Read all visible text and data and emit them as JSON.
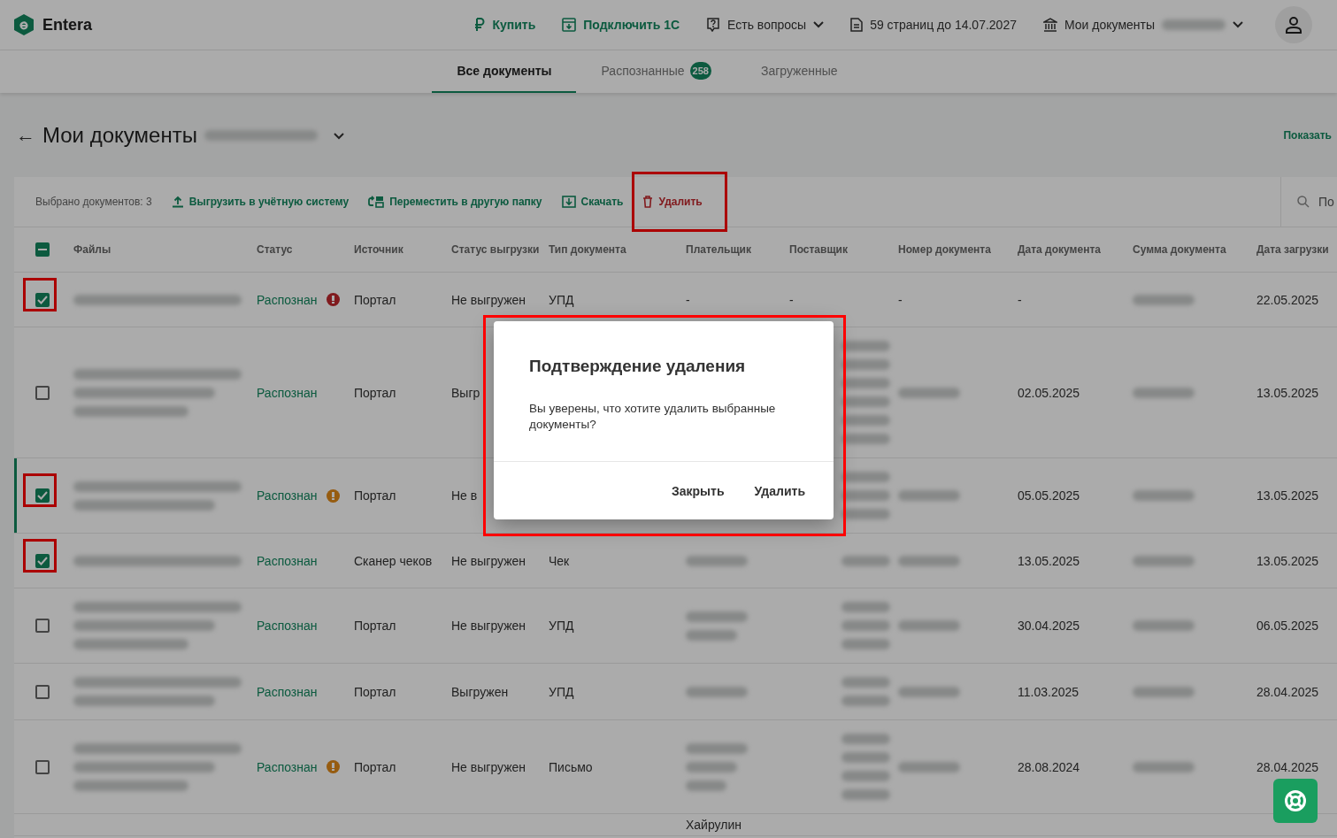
{
  "header": {
    "logo": "Entera",
    "actions": [
      {
        "kind": "buy",
        "label": "Купить"
      },
      {
        "kind": "connect",
        "label": "Подключить 1С"
      },
      {
        "kind": "help",
        "label": "Есть вопросы",
        "dropdown": true
      },
      {
        "kind": "pages",
        "label": "59 страниц до 14.07.2027",
        "dropdown": false
      },
      {
        "kind": "org",
        "label": "Мои документы",
        "dropdown": true,
        "blurred": true
      }
    ]
  },
  "tabs": [
    {
      "label": "Все документы",
      "selected": true
    },
    {
      "label": "Распознанные",
      "badge": "258",
      "selected": false
    },
    {
      "label": "Загруженные",
      "selected": false
    }
  ],
  "page_title": {
    "back": "←",
    "title": "Мои документы",
    "blurred": true
  },
  "show_link": "Показать",
  "toolbar": {
    "selected_count": "Выбрано документов: 3",
    "actions": [
      {
        "kind": "upload",
        "label": "Выгрузить в учётную систему",
        "danger": false,
        "highlighted": false
      },
      {
        "kind": "move",
        "label": "Переместить в другую папку",
        "danger": false,
        "highlighted": false
      },
      {
        "kind": "download",
        "label": "Скачать",
        "danger": false,
        "highlighted": false
      },
      {
        "kind": "delete",
        "label": "Удалить",
        "danger": true,
        "highlighted": true
      }
    ],
    "search": {
      "placeholder": "По"
    }
  },
  "table": {
    "select_all": {
      "indeterminate": true
    },
    "columns": [
      "Файлы",
      "Статус",
      "Источник",
      "Статус выгрузки",
      "Тип документа",
      "Плательщик",
      "Поставщик",
      "Номер документа",
      "Дата документа",
      "Сумма документа",
      "Дата загрузки"
    ],
    "rows": [
      {
        "checked": true,
        "highlighted": true,
        "active": false,
        "status_icon": {
          "color": "#801b1e"
        },
        "cells": [
          [
            {
              "kind": "blurred"
            }
          ],
          "Распознан",
          "Портал",
          "Не выгружен",
          "УПД",
          "-",
          "-",
          "-",
          "-",
          [
            {
              "kind": "blurred"
            }
          ],
          "22.05.2025"
        ]
      },
      {
        "checked": false,
        "highlighted": false,
        "active": false,
        "cells": [
          [
            {
              "kind": "blurred"
            },
            {
              "kind": "blurred"
            },
            {
              "kind": "blurred"
            }
          ],
          "Распознан",
          "Портал",
          "Выгр",
          null,
          null,
          [
            {
              "kind": "blurred"
            },
            {
              "kind": "blurred"
            },
            {
              "kind": "blurred"
            },
            {
              "kind": "blurred"
            },
            {
              "kind": "blurred"
            },
            {
              "kind": "blurred"
            }
          ],
          [
            {
              "kind": "blurred"
            }
          ],
          "02.05.2025",
          [
            {
              "kind": "blurred"
            }
          ],
          "13.05.2025"
        ]
      },
      {
        "checked": true,
        "highlighted": true,
        "active": true,
        "status_icon": {
          "color": "#965c11"
        },
        "cells": [
          [
            {
              "kind": "blurred"
            },
            {
              "kind": "blurred"
            }
          ],
          "Распознан",
          "Портал",
          "Не в",
          null,
          null,
          [
            {
              "kind": "blurred"
            },
            {
              "kind": "blurred"
            },
            {
              "kind": "blurred"
            }
          ],
          [
            {
              "kind": "blurred"
            }
          ],
          "05.05.2025",
          [
            {
              "kind": "blurred"
            }
          ],
          "13.05.2025"
        ]
      },
      {
        "checked": true,
        "highlighted": true,
        "active": false,
        "cells": [
          [
            {
              "kind": "blurred"
            }
          ],
          "Распознан",
          "Сканер чеков",
          "Не выгружен",
          "Чек",
          [
            {
              "kind": "blurred"
            }
          ],
          [
            {
              "kind": "blurred"
            }
          ],
          [
            {
              "kind": "blurred"
            }
          ],
          "13.05.2025",
          [
            {
              "kind": "blurred"
            }
          ],
          "13.05.2025"
        ]
      },
      {
        "checked": false,
        "highlighted": false,
        "active": false,
        "cells": [
          [
            {
              "kind": "blurred"
            },
            {
              "kind": "blurred"
            },
            {
              "kind": "blurred"
            }
          ],
          "Распознан",
          "Портал",
          "Не выгружен",
          "УПД",
          [
            {
              "kind": "blurred"
            },
            {
              "kind": "blurred"
            }
          ],
          [
            {
              "kind": "blurred"
            },
            {
              "kind": "blurred"
            },
            {
              "kind": "blurred"
            }
          ],
          [
            {
              "kind": "blurred"
            }
          ],
          "30.04.2025",
          [
            {
              "kind": "blurred"
            }
          ],
          "06.05.2025"
        ]
      },
      {
        "checked": false,
        "highlighted": false,
        "active": false,
        "cells": [
          [
            {
              "kind": "blurred"
            },
            {
              "kind": "blurred"
            }
          ],
          "Распознан",
          "Портал",
          "Выгружен",
          "УПД",
          [
            {
              "kind": "blurred"
            }
          ],
          [
            {
              "kind": "blurred"
            },
            {
              "kind": "blurred"
            }
          ],
          [
            {
              "kind": "blurred"
            }
          ],
          "11.03.2025",
          [
            {
              "kind": "blurred"
            }
          ],
          "28.04.2025"
        ]
      },
      {
        "checked": false,
        "highlighted": false,
        "active": false,
        "status_icon": {
          "color": "#965c11"
        },
        "cells": [
          [
            {
              "kind": "blurred"
            },
            {
              "kind": "blurred"
            },
            {
              "kind": "blurred"
            }
          ],
          "Распознан",
          "Портал",
          "Не выгружен",
          "Письмо",
          [
            {
              "kind": "blurred"
            },
            {
              "kind": "blurred"
            },
            {
              "kind": "blurred"
            }
          ],
          [
            {
              "kind": "blurred"
            },
            {
              "kind": "blurred"
            },
            {
              "kind": "blurred"
            },
            {
              "kind": "blurred"
            }
          ],
          [
            {
              "kind": "blurred"
            }
          ],
          "28.08.2024",
          [
            {
              "kind": "blurred"
            }
          ],
          "28.04.2025"
        ]
      },
      {
        "cells": [
          null,
          null,
          null,
          null,
          null,
          "Хайрулин",
          null,
          null,
          null,
          null,
          null
        ]
      }
    ]
  },
  "dialog": {
    "title": "Подтверждение удаления",
    "text": "Вы уверены, что хотите удалить выбранные документы?",
    "buttons": [
      "Закрыть",
      "Удалить"
    ],
    "highlighted": true
  }
}
